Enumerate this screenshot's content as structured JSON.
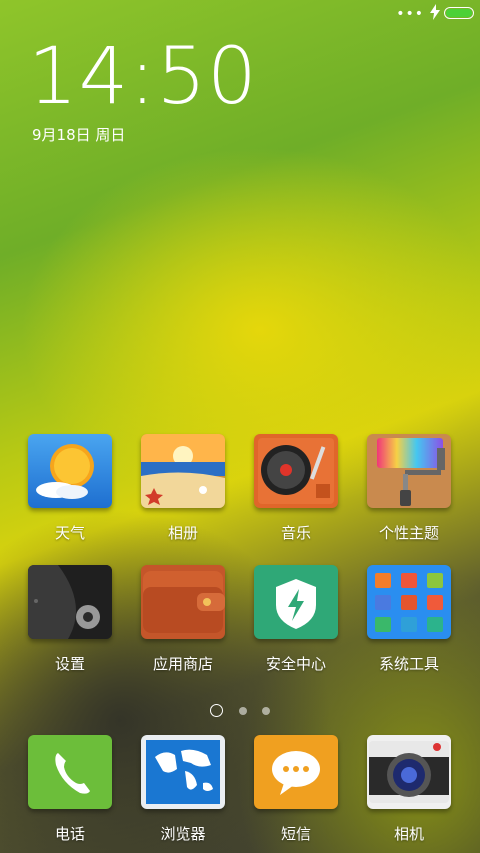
{
  "status_bar": {
    "dots": "•••",
    "battery_color": "#4cd137"
  },
  "lockscreen": {
    "time": "14:50",
    "date": "9月18日 周日"
  },
  "apps_row1": [
    {
      "label": "天气",
      "icon": "weather-icon"
    },
    {
      "label": "相册",
      "icon": "gallery-icon"
    },
    {
      "label": "音乐",
      "icon": "music-icon"
    },
    {
      "label": "个性主题",
      "icon": "themes-icon"
    }
  ],
  "apps_row2": [
    {
      "label": "设置",
      "icon": "settings-icon"
    },
    {
      "label": "应用商店",
      "icon": "app-store-icon"
    },
    {
      "label": "安全中心",
      "icon": "security-icon"
    },
    {
      "label": "系统工具",
      "icon": "tools-folder-icon"
    }
  ],
  "dock": [
    {
      "label": "电话",
      "icon": "phone-icon"
    },
    {
      "label": "浏览器",
      "icon": "browser-icon"
    },
    {
      "label": "短信",
      "icon": "messages-icon"
    },
    {
      "label": "相机",
      "icon": "camera-icon"
    }
  ],
  "page_indicator": {
    "pages": 3,
    "active": 1
  }
}
